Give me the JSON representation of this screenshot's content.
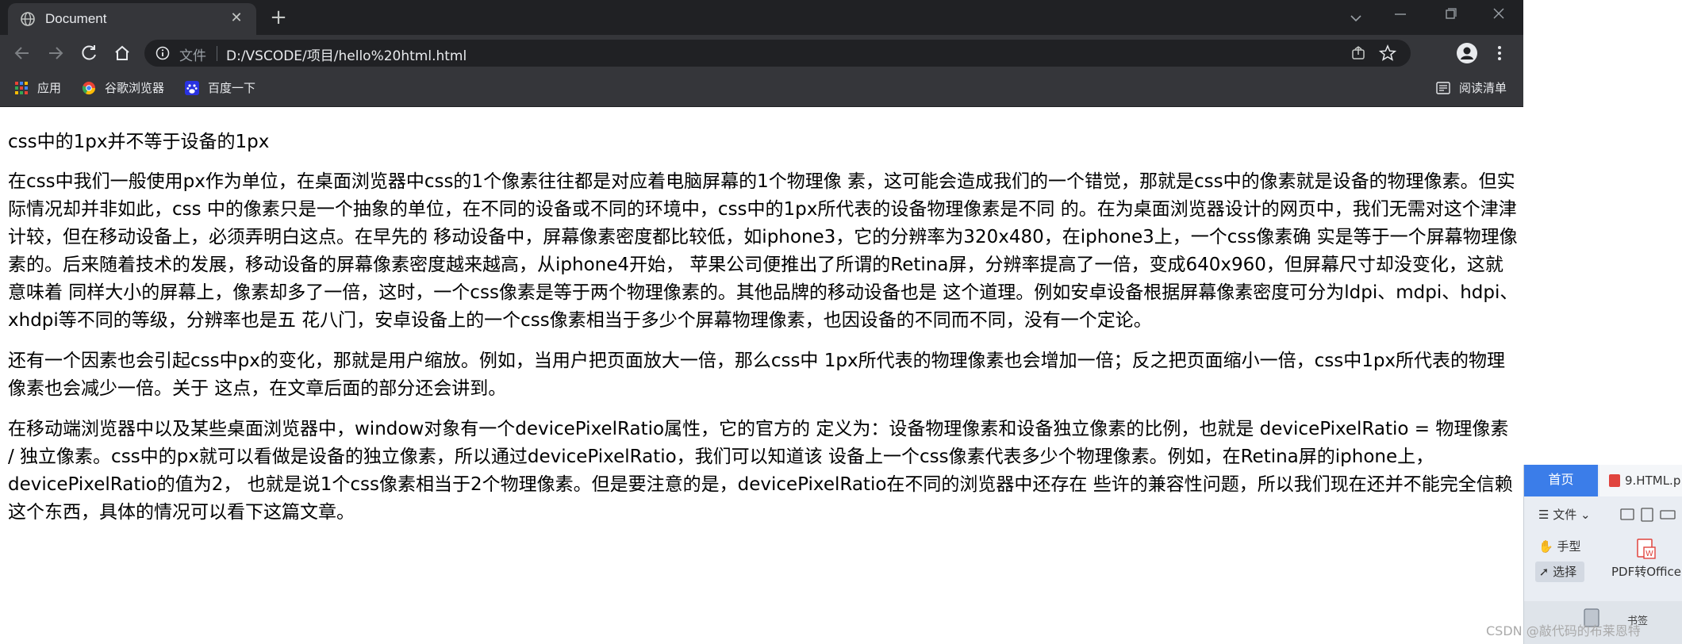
{
  "tab": {
    "title": "Document",
    "close_icon": "close-icon"
  },
  "toolbar": {
    "scheme_label": "文件",
    "url": "D:/VSCODE/项目/hello%20html.html"
  },
  "bookmarks": {
    "items": [
      {
        "label": "应用",
        "icon": "apps-grid-icon"
      },
      {
        "label": "谷歌浏览器",
        "icon": "chrome-icon"
      },
      {
        "label": "百度一下",
        "icon": "baidu-icon"
      }
    ],
    "reading_list": "阅读清单"
  },
  "content": {
    "heading": "css中的1px并不等于设备的1px",
    "paragraphs": [
      "在css中我们一般使用px作为单位，在桌面浏览器中css的1个像素往往都是对应着电脑屏幕的1个物理像 素，这可能会造成我们的一个错觉，那就是css中的像素就是设备的物理像素。但实际情况却并非如此，css 中的像素只是一个抽象的单位，在不同的设备或不同的环境中，css中的1px所代表的设备物理像素是不同 的。在为桌面浏览器设计的网页中，我们无需对这个津津计较，但在移动设备上，必须弄明白这点。在早先的 移动设备中，屏幕像素密度都比较低，如iphone3，它的分辨率为320x480，在iphone3上，一个css像素确 实是等于一个屏幕物理像素的。后来随着技术的发展，移动设备的屏幕像素密度越来越高，从iphone4开始， 苹果公司便推出了所谓的Retina屏，分辨率提高了一倍，变成640x960，但屏幕尺寸却没变化，这就意味着 同样大小的屏幕上，像素却多了一倍，这时，一个css像素是等于两个物理像素的。其他品牌的移动设备也是 这个道理。例如安卓设备根据屏幕像素密度可分为ldpi、mdpi、hdpi、xhdpi等不同的等级，分辨率也是五 花八门，安卓设备上的一个css像素相当于多少个屏幕物理像素，也因设备的不同而不同，没有一个定论。",
      "还有一个因素也会引起css中px的变化，那就是用户缩放。例如，当用户把页面放大一倍，那么css中 1px所代表的物理像素也会增加一倍；反之把页面缩小一倍，css中1px所代表的物理像素也会减少一倍。关于 这点，在文章后面的部分还会讲到。",
      "在移动端浏览器中以及某些桌面浏览器中，window对象有一个devicePixelRatio属性，它的官方的 定义为：设备物理像素和设备独立像素的比例，也就是 devicePixelRatio = 物理像素 / 独立像素。css中的px就可以看做是设备的独立像素，所以通过devicePixelRatio，我们可以知道该 设备上一个css像素代表多少个物理像素。例如，在Retina屏的iphone上，devicePixelRatio的值为2， 也就是说1个css像素相当于2个物理像素。但是要注意的是，devicePixelRatio在不同的浏览器中还存在 些许的兼容性问题，所以我们现在还并不能完全信赖这个东西，具体的情况可以看下这篇文章。"
    ]
  },
  "pdf_panel": {
    "home_tab": "首页",
    "file_tab": "9.HTML.p",
    "file_menu": "文件",
    "hand_tool": "手型",
    "select_tool": "选择",
    "convert_label": "PDF转Office",
    "bookmark_label": "书签"
  },
  "watermark": "CSDN @敲代码的布莱恩特",
  "colors": {
    "tabstrip_bg": "#202124",
    "toolbar_bg": "#35363a",
    "pdf_accent": "#3b7de9"
  }
}
